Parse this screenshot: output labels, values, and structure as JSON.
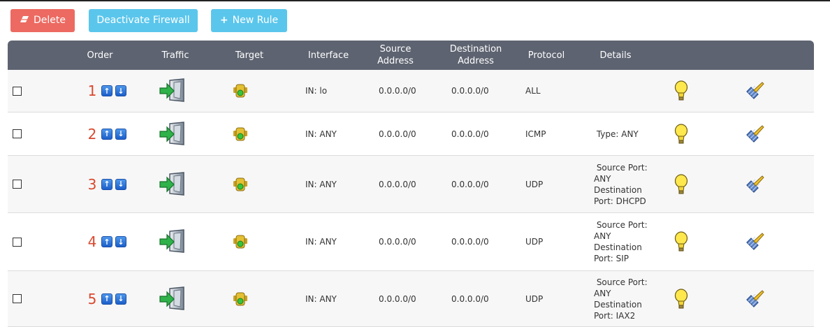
{
  "toolbar": {
    "delete_label": "Delete",
    "deactivate_label": "Deactivate Firewall",
    "new_rule_label": "New Rule"
  },
  "columns": {
    "order": "Order",
    "traffic": "Traffic",
    "target": "Target",
    "interface": "Interface",
    "source_line1": "Source",
    "source_line2": "Address",
    "dest_line1": "Destination",
    "dest_line2": "Address",
    "protocol": "Protocol",
    "details": "Details"
  },
  "rules": [
    {
      "order": "1",
      "interface": "IN: lo",
      "source": "0.0.0.0/0",
      "destination": "0.0.0.0/0",
      "protocol": "ALL",
      "details": [
        "",
        "",
        "",
        ""
      ]
    },
    {
      "order": "2",
      "interface": "IN: ANY",
      "source": "0.0.0.0/0",
      "destination": "0.0.0.0/0",
      "protocol": "ICMP",
      "details": [
        " Type: ANY",
        "",
        "",
        ""
      ]
    },
    {
      "order": "3",
      "interface": "IN: ANY",
      "source": "0.0.0.0/0",
      "destination": "0.0.0.0/0",
      "protocol": "UDP",
      "details": [
        " Source Port:",
        "ANY",
        "Destination",
        "Port: DHCPD"
      ]
    },
    {
      "order": "4",
      "interface": "IN: ANY",
      "source": "0.0.0.0/0",
      "destination": "0.0.0.0/0",
      "protocol": "UDP",
      "details": [
        " Source Port:",
        "ANY",
        "Destination",
        "Port: SIP"
      ]
    },
    {
      "order": "5",
      "interface": "IN: ANY",
      "source": "0.0.0.0/0",
      "destination": "0.0.0.0/0",
      "protocol": "UDP",
      "details": [
        " Source Port:",
        "ANY",
        "Destination",
        "Port: IAX2"
      ]
    }
  ],
  "icons": {
    "delete": "eraser-icon",
    "new_rule": "plus-icon",
    "move_up": "arrow-up-icon",
    "move_down": "arrow-down-icon",
    "traffic": "traffic-in-icon",
    "target": "traffic-light-icon",
    "info": "lightbulb-icon",
    "edit": "edit-brush-icon"
  },
  "colors": {
    "delete_button": "#ec6a61",
    "primary_button": "#5bc6ec",
    "header_bg": "#5d6370",
    "order_number": "#d9482e"
  }
}
